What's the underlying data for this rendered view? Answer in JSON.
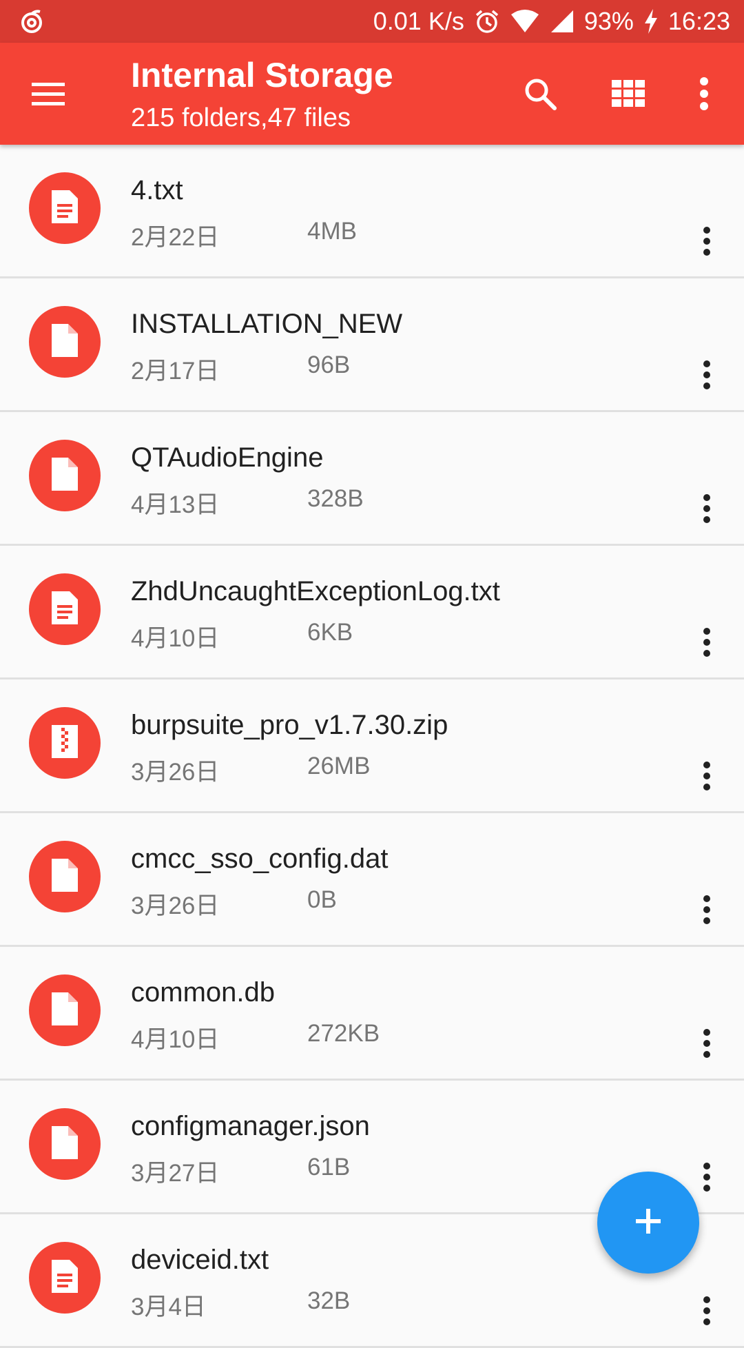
{
  "status_bar": {
    "app_icon": "notification-swirl-icon",
    "network_speed": "0.01 K/s",
    "icons": [
      "alarm-icon",
      "wifi-icon",
      "signal-icon"
    ],
    "battery": "93%",
    "battery_icon": "charging-bolt-icon",
    "time": "16:23"
  },
  "toolbar": {
    "title": "Internal Storage",
    "subtitle": "215 folders,47 files",
    "menu_icon": "menu-icon",
    "search_icon": "search-icon",
    "grid_icon": "grid-view-icon",
    "more_icon": "more-vert-icon",
    "color": "#f44336"
  },
  "files": [
    {
      "name": "4.txt",
      "date": "2月22日",
      "size": "4MB",
      "icon": "text-file-icon"
    },
    {
      "name": "INSTALLATION_NEW",
      "date": "2月17日",
      "size": "96B",
      "icon": "file-icon"
    },
    {
      "name": "QTAudioEngine",
      "date": "4月13日",
      "size": "328B",
      "icon": "file-icon"
    },
    {
      "name": "ZhdUncaughtExceptionLog.txt",
      "date": "4月10日",
      "size": "6KB",
      "icon": "text-file-icon"
    },
    {
      "name": "burpsuite_pro_v1.7.30.zip",
      "date": "3月26日",
      "size": "26MB",
      "icon": "zip-file-icon"
    },
    {
      "name": "cmcc_sso_config.dat",
      "date": "3月26日",
      "size": "0B",
      "icon": "file-icon"
    },
    {
      "name": "common.db",
      "date": "4月10日",
      "size": "272KB",
      "icon": "file-icon"
    },
    {
      "name": "configmanager.json",
      "date": "3月27日",
      "size": "61B",
      "icon": "file-icon"
    },
    {
      "name": "deviceid.txt",
      "date": "3月4日",
      "size": "32B",
      "icon": "text-file-icon"
    }
  ],
  "fab": {
    "icon": "add-icon",
    "color": "#2196f3"
  }
}
